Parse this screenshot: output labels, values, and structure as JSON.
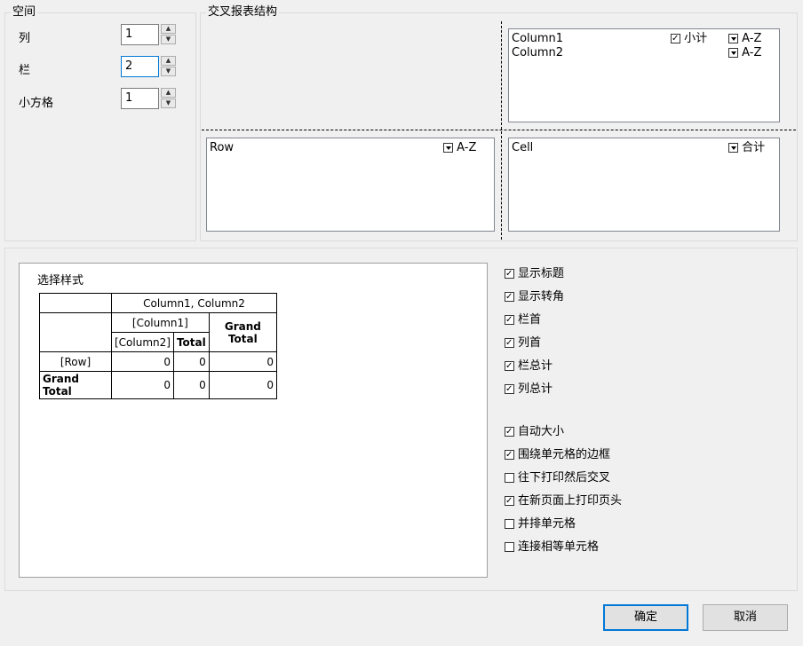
{
  "spacing": {
    "title": "空间",
    "columns_label": "列",
    "columns_value": "1",
    "rows_label": "栏",
    "rows_value": "2",
    "cells_label": "小方格",
    "cells_value": "1"
  },
  "structure": {
    "title": "交叉报表结构",
    "column_fields": [
      {
        "name": "Column1",
        "subtotal": "小计",
        "sort": "A-Z"
      },
      {
        "name": "Column2",
        "sort": "A-Z"
      }
    ],
    "row_field": {
      "name": "Row",
      "sort": "A-Z"
    },
    "cell_field": {
      "name": "Cell",
      "agg": "合计"
    }
  },
  "preview": {
    "title": "选择样式",
    "header_columns": "Column1, Column2",
    "column1": "[Column1]",
    "column2": "[Column2]",
    "total": "Total",
    "grand_total": "Grand Total",
    "row": "[Row]",
    "v0": "0"
  },
  "options": [
    {
      "label": "显示标题",
      "checked": true
    },
    {
      "label": "显示转角",
      "checked": true
    },
    {
      "label": "栏首",
      "checked": true
    },
    {
      "label": "列首",
      "checked": true
    },
    {
      "label": "栏总计",
      "checked": true
    },
    {
      "label": "列总计",
      "checked": true
    },
    {
      "label": "自动大小",
      "checked": true
    },
    {
      "label": "围绕单元格的边框",
      "checked": true
    },
    {
      "label": "往下打印然后交叉",
      "checked": false
    },
    {
      "label": "在新页面上打印页头",
      "checked": true
    },
    {
      "label": "并排单元格",
      "checked": false
    },
    {
      "label": "连接相等单元格",
      "checked": false
    }
  ],
  "buttons": {
    "ok": "确定",
    "cancel": "取消"
  }
}
